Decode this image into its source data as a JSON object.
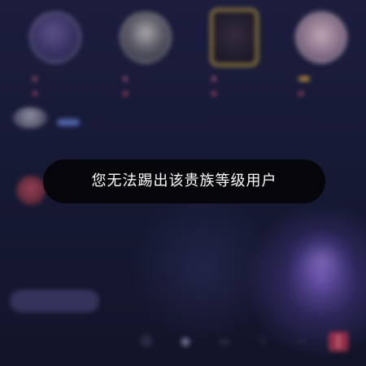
{
  "toast": {
    "message": "您无法踢出该贵族等级用户"
  },
  "seats": [
    {
      "icon": "avatar",
      "sub1": "",
      "sub2": ""
    },
    {
      "icon": "avatar",
      "sub1": "",
      "sub2": ""
    },
    {
      "icon": "avatar-frame",
      "sub1": "",
      "sub2": ""
    },
    {
      "icon": "avatar",
      "sub1": "",
      "sub2": ""
    }
  ],
  "chat": {
    "messages": []
  },
  "bottom_bar": {
    "input_placeholder": ""
  },
  "colors": {
    "toast_bg": "#040408",
    "toast_text": "#ffffff",
    "accent_purple": "#b07bd8",
    "gift_red": "#b0324c"
  }
}
